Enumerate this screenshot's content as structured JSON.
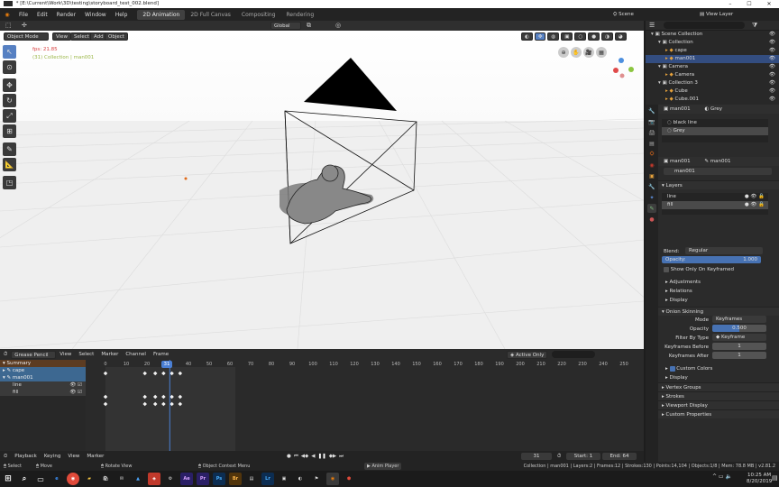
{
  "titlebar": {
    "title": "* [E:\\Current\\Work\\3D\\testing\\storyboard_test_002.blend]"
  },
  "menu": [
    "File",
    "Edit",
    "Render",
    "Window",
    "Help"
  ],
  "workspaces": [
    "2D Animation",
    "2D Full Canvas",
    "Compositing",
    "Rendering"
  ],
  "scene": {
    "label": "Scene",
    "view_layer": "View Layer"
  },
  "view3d": {
    "orientation": "Global",
    "mode": "Object Mode",
    "menu": [
      "View",
      "Select",
      "Add",
      "Object"
    ],
    "fps": "fps: 21.85",
    "info": "(31) Collection | man001"
  },
  "outliner": {
    "items": [
      {
        "label": "Scene Collection",
        "indent": 0
      },
      {
        "label": "Collection",
        "indent": 1
      },
      {
        "label": "cape",
        "indent": 2
      },
      {
        "label": "man001",
        "indent": 2,
        "selected": true
      },
      {
        "label": "Camera",
        "indent": 1
      },
      {
        "label": "Camera",
        "indent": 2
      },
      {
        "label": "Collection 3",
        "indent": 1
      },
      {
        "label": "Cube",
        "indent": 2
      },
      {
        "label": "Cube.001",
        "indent": 2
      }
    ]
  },
  "materials": {
    "object": "man001",
    "material": "Grey",
    "slots": [
      {
        "label": "black line"
      },
      {
        "label": "Grey",
        "selected": true
      }
    ]
  },
  "data_panel": {
    "object": "man001",
    "data": "man001",
    "datablock": "man001",
    "layers_header": "Layers",
    "layers": [
      {
        "label": "line"
      },
      {
        "label": "fill",
        "selected": true
      }
    ],
    "blend_label": "Blend:",
    "blend_value": "Regular",
    "opacity_label": "Opacity:",
    "opacity_value": "1.000",
    "show_keyframed": "Show Only On Keyframed",
    "sub_sections": [
      "Adjustments",
      "Relations",
      "Display"
    ]
  },
  "onion": {
    "header": "Onion Skinning",
    "mode_label": "Mode",
    "mode_value": "Keyframes",
    "opacity_label": "Opacity",
    "opacity_value": "0.500",
    "filter_label": "Filter By Type",
    "filter_value": "Keyframe",
    "before_label": "Keyframes Before",
    "before_value": "1",
    "after_label": "Keyframes After",
    "after_value": "1",
    "custom_colors": "Custom Colors",
    "display": "Display"
  },
  "more_sections": [
    "Vertex Groups",
    "Strokes",
    "Viewport Display",
    "Custom Properties"
  ],
  "timeline": {
    "editor": "Grease Pencil",
    "menu": [
      "View",
      "Select",
      "Marker",
      "Channel",
      "Frame"
    ],
    "filter": "Active Only",
    "current_frame": "31",
    "ticks": [
      "0",
      "10",
      "20",
      "31",
      "40",
      "50",
      "60",
      "70",
      "80",
      "90",
      "100",
      "110",
      "120",
      "130",
      "140",
      "150",
      "160",
      "170",
      "180",
      "190",
      "200",
      "210",
      "220",
      "230",
      "240",
      "250"
    ],
    "channels": [
      {
        "label": "Summary",
        "kind": "summary"
      },
      {
        "label": "cape",
        "kind": "object"
      },
      {
        "label": "man001",
        "kind": "object"
      },
      {
        "label": "line",
        "kind": "layer"
      },
      {
        "label": "fill",
        "kind": "layer"
      }
    ],
    "summary_keys": [
      0,
      19,
      24,
      28,
      32,
      36
    ],
    "layer_keys": [
      0,
      19,
      24,
      28,
      32,
      36
    ]
  },
  "playback": {
    "menu": [
      "Playback",
      "Keying",
      "View",
      "Marker"
    ],
    "frame": "31",
    "start_label": "Start:",
    "start": "1",
    "end_label": "End:",
    "end": "64"
  },
  "statusbar": {
    "items": [
      "Select",
      "Move",
      "Rotate View",
      "Object Context Menu",
      "Anim Player"
    ],
    "info": "Collection | man001 | Layers:2 | Frames:12 | Strokes:130 | Points:14,104 | Objects:1/8 | Mem: 78.8 MB | v2.81.2"
  },
  "taskbar": {
    "apps": [
      {
        "name": "Ae",
        "color": "#2a1f66"
      },
      {
        "name": "Pr",
        "color": "#2a1f66"
      },
      {
        "name": "Ps",
        "color": "#0c2d52"
      },
      {
        "name": "Br",
        "color": "#52350c"
      },
      {
        "name": "Lr",
        "color": "#0c2d52"
      }
    ],
    "time": "10:25 AM",
    "date": "8/20/2019"
  }
}
